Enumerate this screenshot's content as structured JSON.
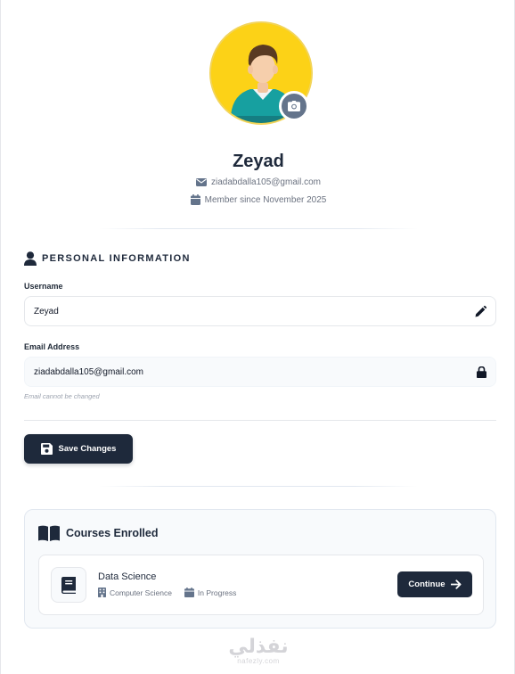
{
  "profile": {
    "name": "Zeyad",
    "email": "ziadabdalla105@gmail.com",
    "member_since": "Member since November 2025"
  },
  "icons": {
    "camera": "camera-icon",
    "envelope": "envelope-icon",
    "calendar": "calendar-icon",
    "user": "user-icon",
    "pencil": "pencil-icon",
    "lock": "lock-icon",
    "save": "floppy-disk-icon",
    "book": "open-book-icon",
    "course": "book-icon",
    "building": "building-icon",
    "arrow": "arrow-right-icon"
  },
  "personal_info": {
    "title": "PERSONAL INFORMATION",
    "username_label": "Username",
    "username_value": "Zeyad",
    "email_label": "Email Address",
    "email_value": "ziadabdalla105@gmail.com",
    "email_hint": "Email cannot be changed",
    "save_label": "Save Changes"
  },
  "courses": {
    "title": "Courses Enrolled",
    "items": [
      {
        "name": "Data Science",
        "department": "Computer Science",
        "status": "In Progress",
        "action_label": "Continue"
      }
    ]
  },
  "watermark": {
    "arabic": "نفذلي",
    "latin": "nafezly.com"
  },
  "colors": {
    "primary_dark": "#1e293b",
    "avatar_bg": "#fcd217",
    "muted_text": "#6b7280",
    "panel_bg": "#f8fafc"
  }
}
